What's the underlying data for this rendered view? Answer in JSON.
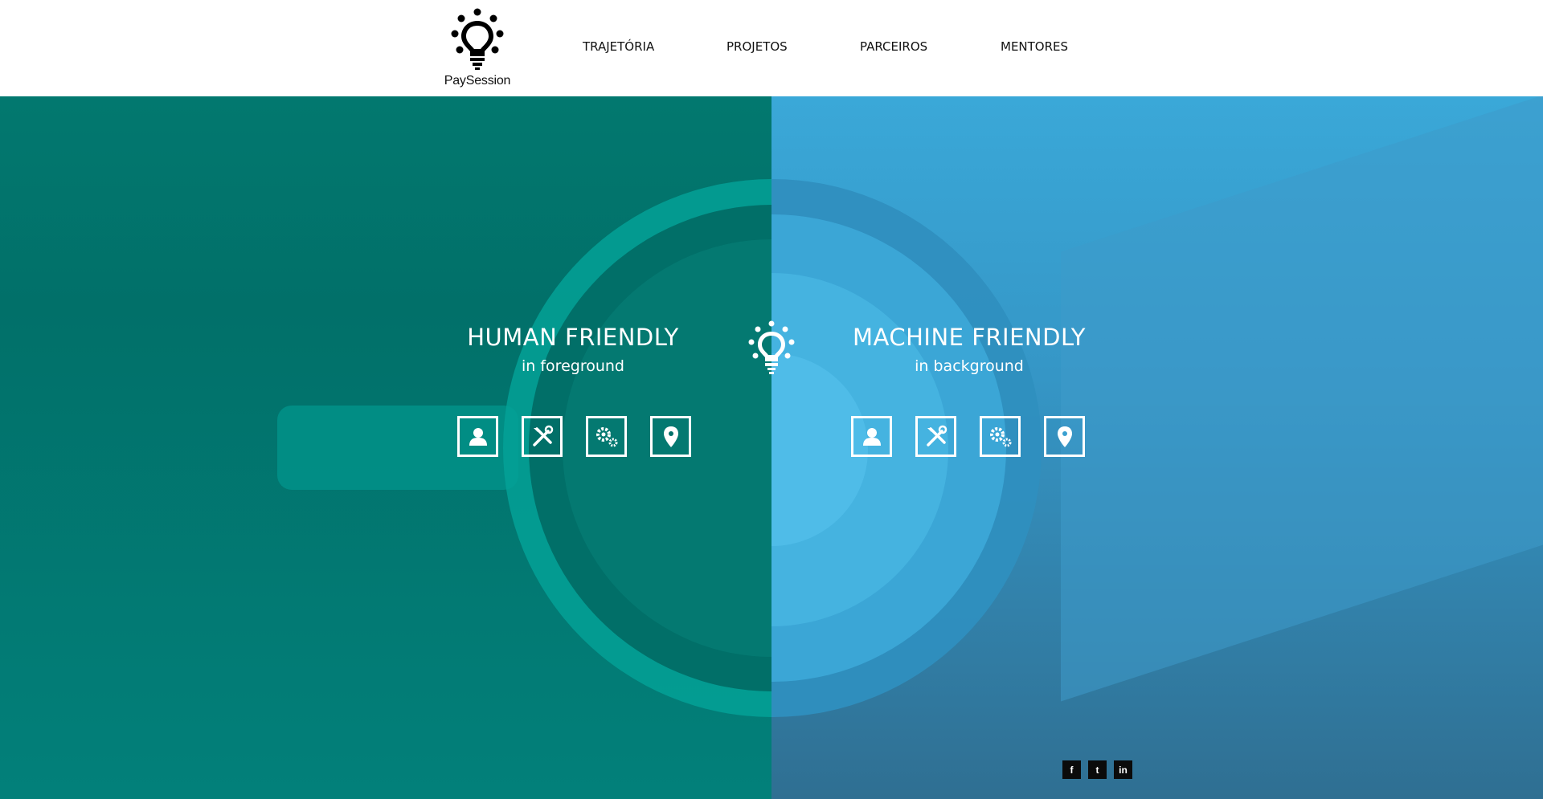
{
  "header": {
    "logo_text": "PaySession",
    "nav": [
      {
        "label": "TRAJETÓRIA"
      },
      {
        "label": "PROJETOS"
      },
      {
        "label": "PARCEIROS"
      },
      {
        "label": "MENTORES"
      }
    ]
  },
  "hero": {
    "left": {
      "title": "HUMAN FRIENDLY",
      "subtitle": "in foreground",
      "icons": [
        "user-icon",
        "tools-icon",
        "gears-icon",
        "location-pin-icon"
      ],
      "color": "#017069"
    },
    "right": {
      "title": "MACHINE FRIENDLY",
      "subtitle": "in background",
      "icons": [
        "user-icon",
        "tools-icon",
        "gears-icon",
        "location-pin-icon"
      ],
      "color": "#3596c6"
    },
    "center_icon": "lightbulb-icon"
  },
  "social": [
    {
      "icon": "facebook-icon",
      "glyph": "f"
    },
    {
      "icon": "twitter-icon",
      "glyph": "t"
    },
    {
      "icon": "linkedin-icon",
      "glyph": "in"
    }
  ]
}
